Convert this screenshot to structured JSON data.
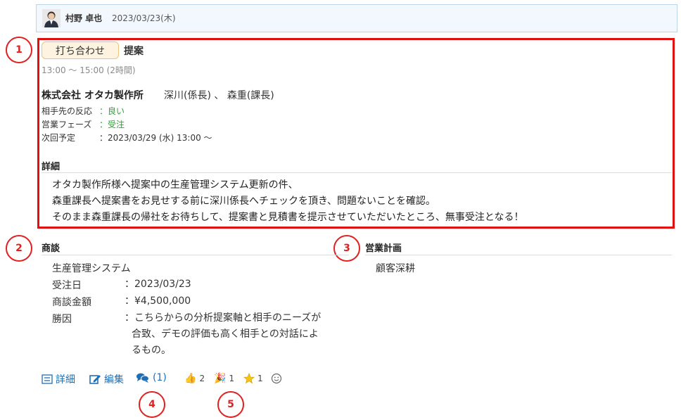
{
  "header": {
    "user_name": "村野 卓也",
    "date": "2023/03/23(木)"
  },
  "callouts": [
    "1",
    "2",
    "3",
    "4",
    "5"
  ],
  "activity": {
    "tag": "打ち合わせ",
    "title": "提案",
    "time": "13:00 〜 15:00 (2時間)",
    "company": "株式会社 オタカ製作所",
    "persons": "深川(係長) 、 森重(課長)",
    "fields": [
      {
        "label": "相手先の反応",
        "value": "：良い"
      },
      {
        "label": "営業フェーズ",
        "value": "：受注"
      },
      {
        "label": "次回予定",
        "value": "：2023/03/29 (水) 13:00 〜"
      }
    ],
    "detail_heading": "詳細",
    "detail_lines": [
      "オタカ製作所様へ提案中の生産管理システム更新の件、",
      "森重課長へ提案書をお見せする前に深川係長へチェックを頂き、問題ないことを確認。",
      "そのまま森重課長の帰社をお待ちして、提案書と見積書を提示させていただいたところ、無事受注となる！"
    ]
  },
  "deal": {
    "heading": "商談",
    "name": "生産管理システム",
    "rows": [
      {
        "label": "受注日",
        "value": "：2023/03/23"
      },
      {
        "label": "商談金額",
        "value": "：¥4,500,000"
      },
      {
        "label": "勝因",
        "value": "：こちらからの分析提案軸と相手のニーズが"
      }
    ],
    "reason_cont": [
      "合致、デモの評価も高く相手との対話によ",
      "るもの。"
    ]
  },
  "plan": {
    "heading": "営業計画",
    "value": "顧客深耕"
  },
  "footer": {
    "detail_label": "詳細",
    "edit_label": "編集",
    "comment_label": "(1)",
    "reactions": [
      {
        "icon": "thumbs-up-icon",
        "count": "2"
      },
      {
        "icon": "party-popper-icon",
        "count": "1"
      },
      {
        "icon": "star-icon",
        "count": "1"
      }
    ]
  },
  "colors": {
    "accent": "#1f6fb5",
    "highlight": "#e01010",
    "positive": "#2e9e36"
  }
}
